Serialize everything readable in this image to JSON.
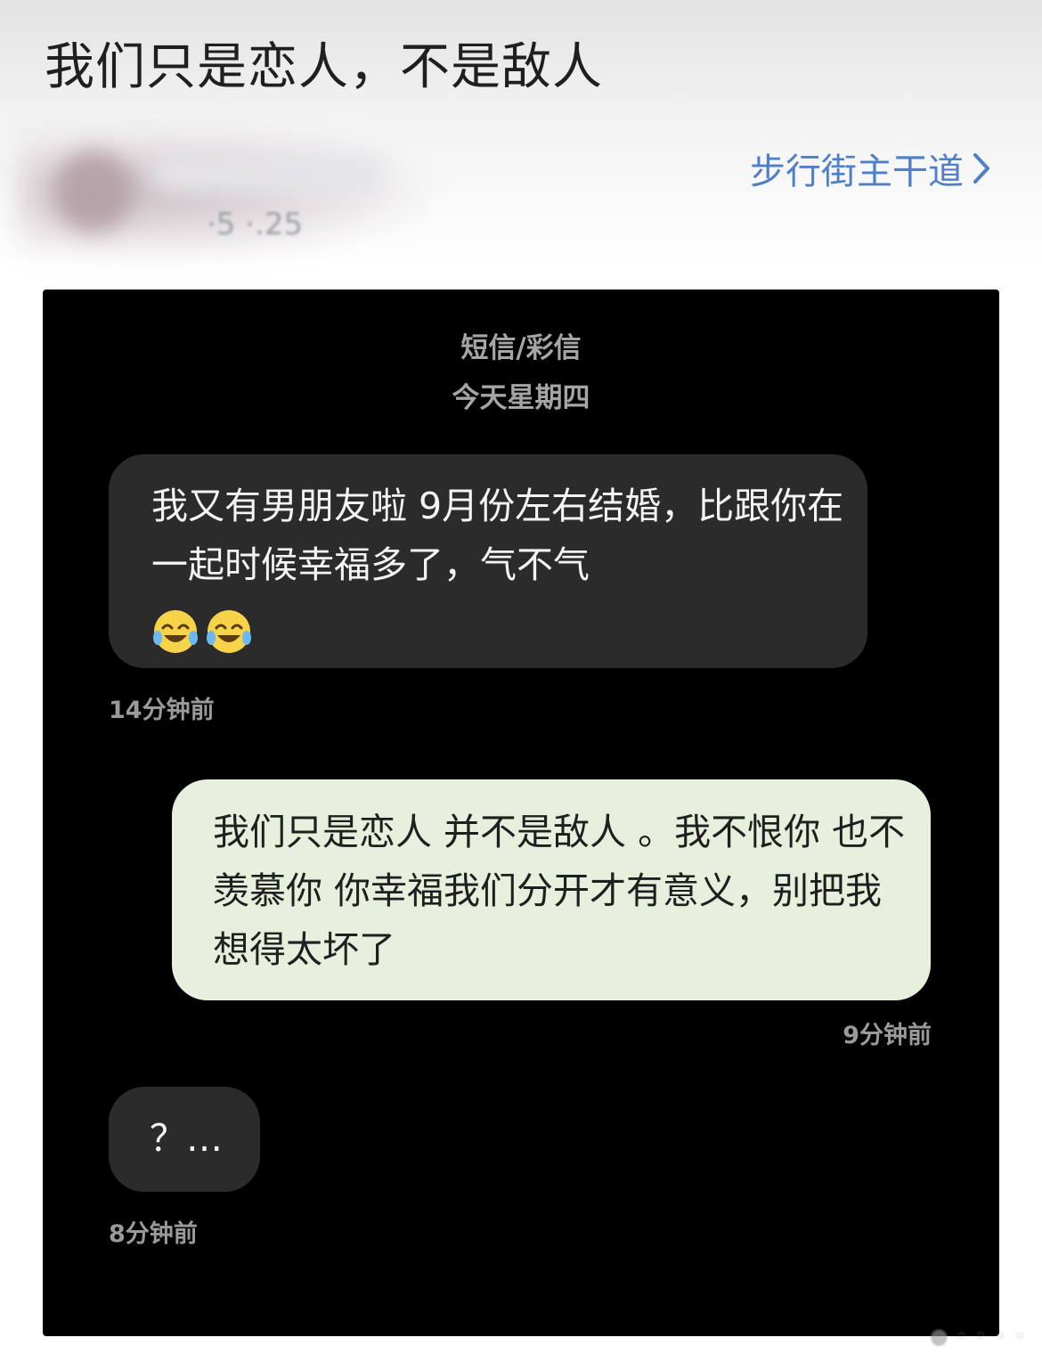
{
  "post": {
    "title": "我们只是恋人，不是敌人",
    "time_partial": "·5 ·.25",
    "topic_link": "步行街主干道"
  },
  "sms": {
    "header": "短信/彩信",
    "date": "今天星期四",
    "messages": [
      {
        "direction": "incoming",
        "text": "我又有男朋友啦 9月份左右结婚，比跟你在一起时候幸福多了，气不气",
        "emoji_icons": [
          "tears-of-joy-emoji-icon",
          "tears-of-joy-emoji-icon"
        ],
        "time": "14分钟前"
      },
      {
        "direction": "outgoing",
        "text": "我们只是恋人 并不是敌人 。我不恨你 也不羡慕你 你幸福我们分开才有意义，别把我想得太坏了",
        "time": "9分钟前"
      },
      {
        "direction": "incoming",
        "text": "？…",
        "time": "8分钟前"
      }
    ]
  },
  "colors": {
    "link_blue": "#4f7fc7",
    "dark_bg": "#000000",
    "incoming_bubble": "#2b2b2b",
    "outgoing_bubble": "#e6f0dc"
  }
}
